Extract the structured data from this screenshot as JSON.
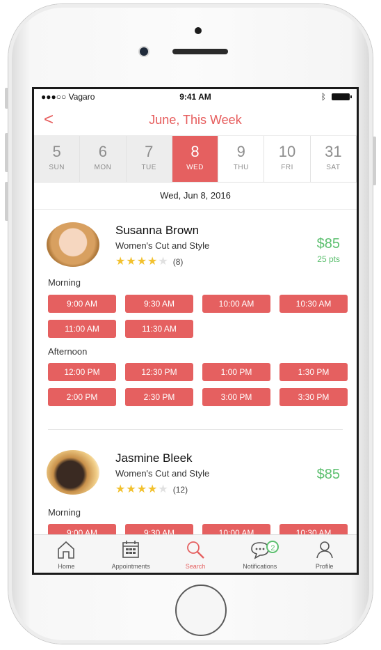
{
  "status": {
    "carrier": "●●●○○ Vagaro",
    "time": "9:41 AM"
  },
  "nav": {
    "back": "<",
    "title": "June, This Week"
  },
  "days": [
    {
      "num": "5",
      "dow": "SUN",
      "state": "past"
    },
    {
      "num": "6",
      "dow": "MON",
      "state": "past"
    },
    {
      "num": "7",
      "dow": "TUE",
      "state": "past"
    },
    {
      "num": "8",
      "dow": "WED",
      "state": "active"
    },
    {
      "num": "9",
      "dow": "THU",
      "state": "future"
    },
    {
      "num": "10",
      "dow": "FRI",
      "state": "future"
    },
    {
      "num": "31",
      "dow": "SAT",
      "state": "future"
    }
  ],
  "selected_date": "Wed, Jun 8, 2016",
  "providers": [
    {
      "name": "Susanna Brown",
      "service": "Women's Cut and Style",
      "rating": 4,
      "reviews": "(8)",
      "price": "$85",
      "points": "25 pts",
      "morning_label": "Morning",
      "morning": [
        "9:00 AM",
        "9:30 AM",
        "10:00 AM",
        "10:30 AM",
        "11:00 AM",
        "11:30 AM"
      ],
      "afternoon_label": "Afternoon",
      "afternoon": [
        "12:00 PM",
        "12:30 PM",
        "1:00 PM",
        "1:30 PM",
        "2:00 PM",
        "2:30 PM",
        "3:00 PM",
        "3:30 PM"
      ]
    },
    {
      "name": "Jasmine Bleek",
      "service": "Women's Cut and Style",
      "rating": 4,
      "reviews": "(12)",
      "price": "$85",
      "morning_label": "Morning",
      "morning": [
        "9:00 AM",
        "9:30 AM",
        "10:00 AM",
        "10:30 AM"
      ]
    }
  ],
  "tabs": [
    {
      "label": "Home",
      "icon": "home-icon"
    },
    {
      "label": "Appointments",
      "icon": "calendar-icon"
    },
    {
      "label": "Search",
      "icon": "search-icon",
      "active": true
    },
    {
      "label": "Notifications",
      "icon": "chat-icon",
      "badge": "2"
    },
    {
      "label": "Profile",
      "icon": "person-icon"
    }
  ]
}
